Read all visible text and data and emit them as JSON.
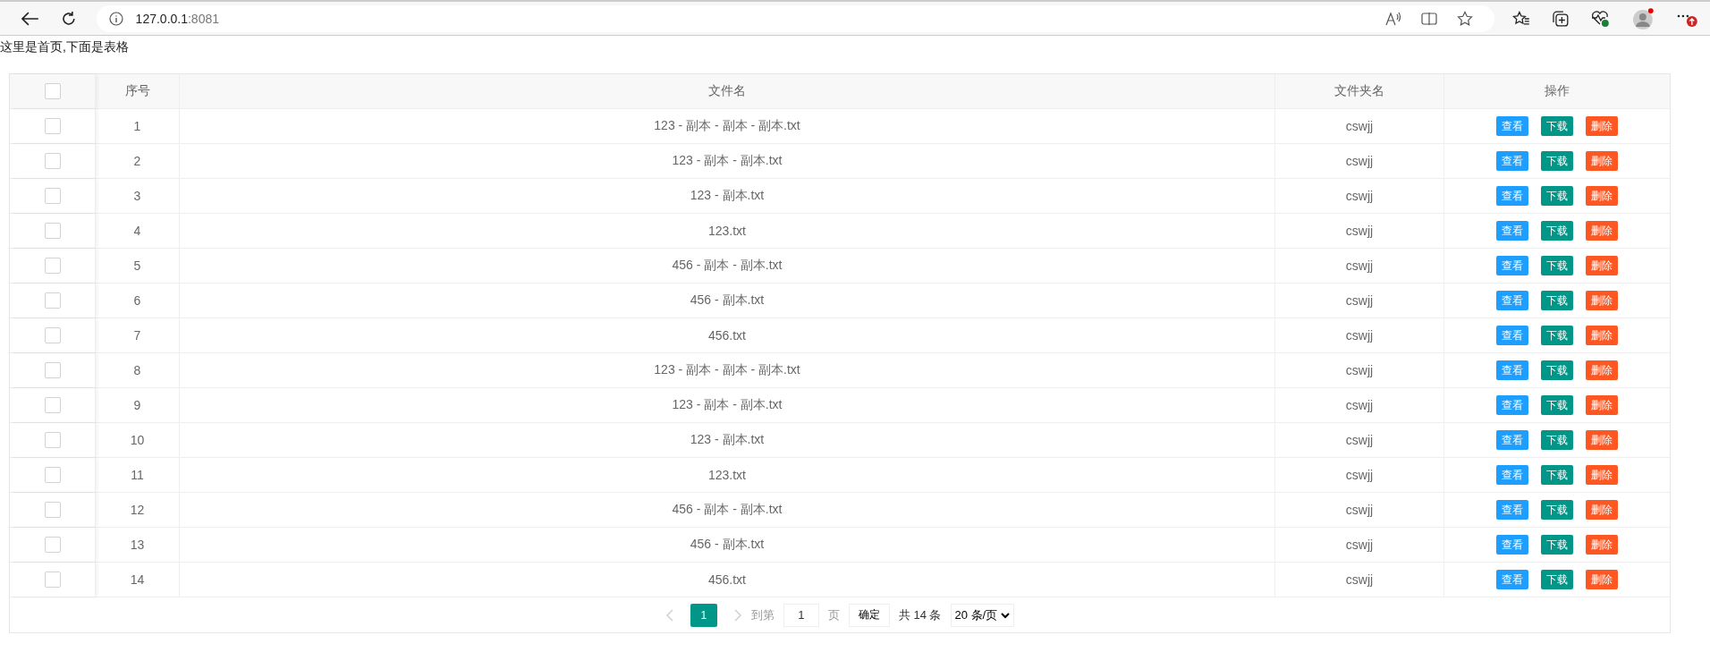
{
  "browser": {
    "url_host": "127.0.0.1",
    "url_port": ":8081"
  },
  "page_heading": "这里是首页,下面是表格",
  "table": {
    "header_checked": false,
    "columns": [
      "序号",
      "文件名",
      "文件夹名",
      "操作"
    ],
    "rows": [
      {
        "checked": false,
        "index": "1",
        "file": "123 - 副本 - 副本 - 副本.txt",
        "folder": "cswjj",
        "actions": [
          {
            "kind": "view",
            "label": "查看"
          },
          {
            "kind": "download",
            "label": "下载"
          },
          {
            "kind": "delete",
            "label": "删除"
          }
        ]
      },
      {
        "checked": false,
        "index": "2",
        "file": "123 - 副本 - 副本.txt",
        "folder": "cswjj",
        "actions": [
          {
            "kind": "view",
            "label": "查看"
          },
          {
            "kind": "download",
            "label": "下载"
          },
          {
            "kind": "delete",
            "label": "删除"
          }
        ]
      },
      {
        "checked": false,
        "index": "3",
        "file": "123 - 副本.txt",
        "folder": "cswjj",
        "actions": [
          {
            "kind": "view",
            "label": "查看"
          },
          {
            "kind": "download",
            "label": "下载"
          },
          {
            "kind": "delete",
            "label": "删除"
          }
        ]
      },
      {
        "checked": false,
        "index": "4",
        "file": "123.txt",
        "folder": "cswjj",
        "actions": [
          {
            "kind": "view",
            "label": "查看"
          },
          {
            "kind": "download",
            "label": "下载"
          },
          {
            "kind": "delete",
            "label": "删除"
          }
        ]
      },
      {
        "checked": false,
        "index": "5",
        "file": "456 - 副本 - 副本.txt",
        "folder": "cswjj",
        "actions": [
          {
            "kind": "view",
            "label": "查看"
          },
          {
            "kind": "download",
            "label": "下载"
          },
          {
            "kind": "delete",
            "label": "删除"
          }
        ]
      },
      {
        "checked": false,
        "index": "6",
        "file": "456 - 副本.txt",
        "folder": "cswjj",
        "actions": [
          {
            "kind": "view",
            "label": "查看"
          },
          {
            "kind": "download",
            "label": "下载"
          },
          {
            "kind": "delete",
            "label": "删除"
          }
        ]
      },
      {
        "checked": false,
        "index": "7",
        "file": "456.txt",
        "folder": "cswjj",
        "actions": [
          {
            "kind": "view",
            "label": "查看"
          },
          {
            "kind": "download",
            "label": "下载"
          },
          {
            "kind": "delete",
            "label": "删除"
          }
        ]
      },
      {
        "checked": false,
        "index": "8",
        "file": "123 - 副本 - 副本 - 副本.txt",
        "folder": "cswjj",
        "actions": [
          {
            "kind": "view",
            "label": "查看"
          },
          {
            "kind": "download",
            "label": "下载"
          },
          {
            "kind": "delete",
            "label": "删除"
          }
        ]
      },
      {
        "checked": false,
        "index": "9",
        "file": "123 - 副本 - 副本.txt",
        "folder": "cswjj",
        "actions": [
          {
            "kind": "view",
            "label": "查看"
          },
          {
            "kind": "download",
            "label": "下载"
          },
          {
            "kind": "delete",
            "label": "删除"
          }
        ]
      },
      {
        "checked": false,
        "index": "10",
        "file": "123 - 副本.txt",
        "folder": "cswjj",
        "actions": [
          {
            "kind": "view",
            "label": "查看"
          },
          {
            "kind": "download",
            "label": "下载"
          },
          {
            "kind": "delete",
            "label": "删除"
          }
        ]
      },
      {
        "checked": false,
        "index": "11",
        "file": "123.txt",
        "folder": "cswjj",
        "actions": [
          {
            "kind": "view",
            "label": "查看"
          },
          {
            "kind": "download",
            "label": "下载"
          },
          {
            "kind": "delete",
            "label": "删除"
          }
        ]
      },
      {
        "checked": false,
        "index": "12",
        "file": "456 - 副本 - 副本.txt",
        "folder": "cswjj",
        "actions": [
          {
            "kind": "view",
            "label": "查看"
          },
          {
            "kind": "download",
            "label": "下载"
          },
          {
            "kind": "delete",
            "label": "删除"
          }
        ]
      },
      {
        "checked": false,
        "index": "13",
        "file": "456 - 副本.txt",
        "folder": "cswjj",
        "actions": [
          {
            "kind": "view",
            "label": "查看"
          },
          {
            "kind": "download",
            "label": "下载"
          },
          {
            "kind": "delete",
            "label": "删除"
          }
        ]
      },
      {
        "checked": false,
        "index": "14",
        "file": "456.txt",
        "folder": "cswjj",
        "actions": [
          {
            "kind": "view",
            "label": "查看"
          },
          {
            "kind": "download",
            "label": "下载"
          },
          {
            "kind": "delete",
            "label": "删除"
          }
        ]
      }
    ]
  },
  "pagination": {
    "pages": [
      {
        "label": "1",
        "selected": true
      }
    ],
    "goto_label": "到第",
    "goto_value": "1",
    "page_unit": "页",
    "confirm": "确定",
    "total": "共 14 条",
    "page_size": "20 条/页"
  }
}
